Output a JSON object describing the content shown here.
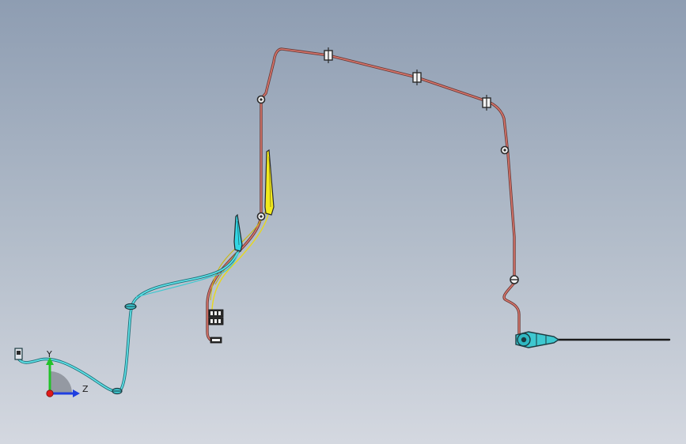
{
  "viewport": {
    "background_top": "#8e9db2",
    "background_bottom": "#d4d8e0"
  },
  "harness": {
    "colors": {
      "red_harness": "#c8625a",
      "red_harness_outline": "#6b3a36",
      "cyan_harness": "#3ec8d0",
      "cyan_harness_outline": "#1c6f78",
      "yellow_wire": "#f0e21a",
      "yellow_part_fill": "#f2ea1c",
      "cyan_part_fill": "#33d6e4",
      "antenna_rod": "#1a1a1a",
      "connector_dark": "#2a2a2a",
      "clip_color": "#3a3a3a"
    }
  },
  "triad": {
    "labels": {
      "y": "Y",
      "z": "Z"
    },
    "colors": {
      "y_axis": "#22c22a",
      "z_axis": "#1f3fe0",
      "x_origin": "#e01a1a",
      "quadrant": "#8b8f98"
    }
  }
}
